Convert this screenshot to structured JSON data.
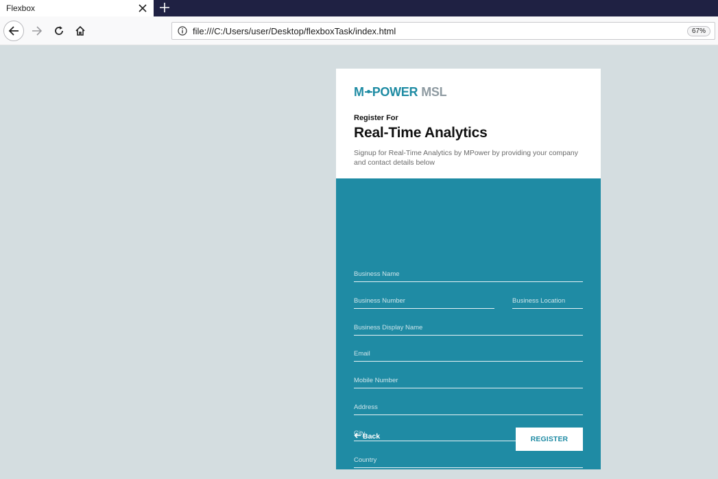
{
  "browser": {
    "tab_title": "Flexbox",
    "url": "file:///C:/Users/user/Desktop/flexboxTask/index.html",
    "zoom": "67%"
  },
  "page": {
    "logo": {
      "m": "M",
      "power": "POWER",
      "msl": "MSL"
    },
    "register_for": "Register For",
    "title": "Real-Time Analytics",
    "subtitle": "Signup for Real-Time Analytics by MPower by providing your company and contact details below",
    "fields": {
      "business_name": "Business Name",
      "business_number": "Business Number",
      "business_location": "Business Location",
      "business_display_name": "Business Display Name",
      "email": "Email",
      "mobile_number": "Mobile Number",
      "address": "Address",
      "city": "City",
      "country": "Country"
    },
    "back_label": "Back",
    "register_label": "REGISTER"
  },
  "colors": {
    "accent": "#1f8ba4",
    "page_bg": "#d4dde0",
    "tabbar_bg": "#1f2143"
  },
  "icons": [
    "close-icon",
    "plus-icon",
    "back-arrow-icon",
    "forward-arrow-icon",
    "reload-icon",
    "home-icon",
    "info-icon",
    "left-arrow-icon"
  ]
}
